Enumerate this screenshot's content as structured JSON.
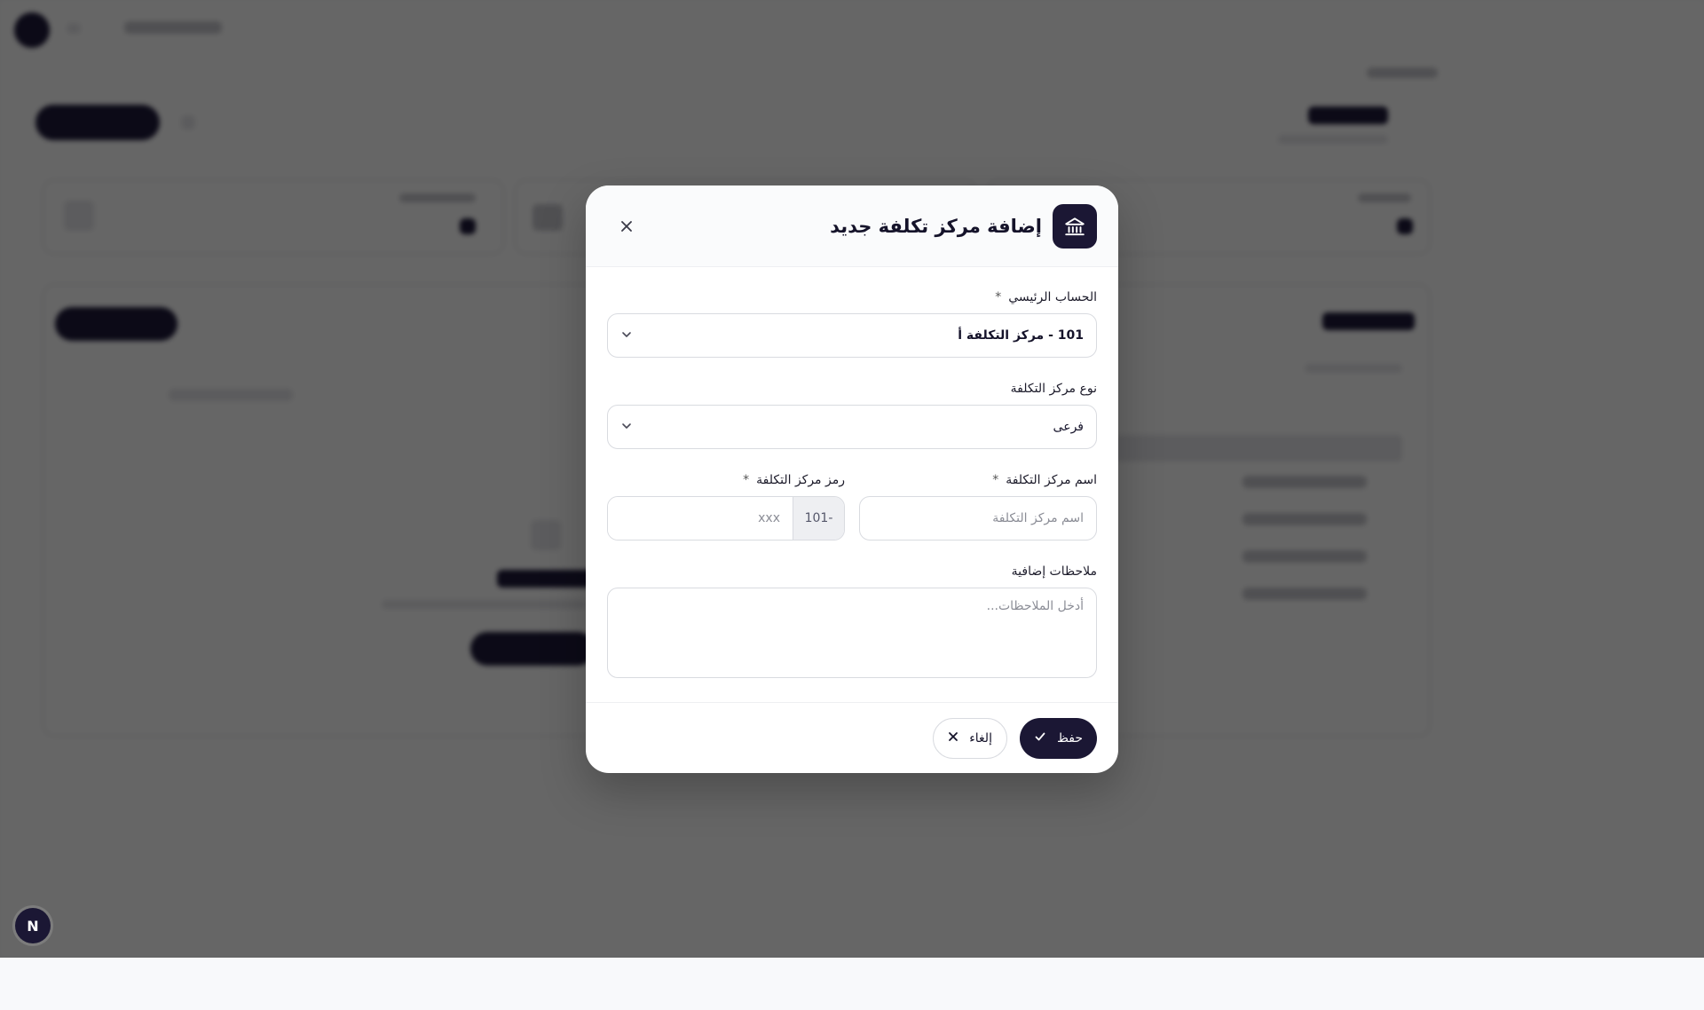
{
  "modal": {
    "title": "إضافة مركز تكلفة جديد",
    "close_label": "close",
    "fields": {
      "parent_account": {
        "label": "الحساب الرئيسي",
        "required_mark": "*",
        "value": "101 - مركز التكلفة أ"
      },
      "cost_center_type": {
        "label": "نوع مركز التكلفة",
        "value": "فرعى"
      },
      "cost_center_name": {
        "label": "اسم مركز التكلفة",
        "required_mark": "*",
        "placeholder": "اسم مركز التكلفة"
      },
      "cost_center_code": {
        "label": "رمز مركز التكلفة",
        "required_mark": "*",
        "prefix": "101-",
        "placeholder": "xxx"
      },
      "notes": {
        "label": "ملاحظات إضافية",
        "placeholder": "أدخل الملاحظات..."
      }
    },
    "footer": {
      "save_label": "حفظ",
      "cancel_label": "إلغاء"
    }
  },
  "fab": {
    "label": "N"
  },
  "colors": {
    "primary": "#1b1734",
    "overlay": "rgba(0,0,0,0.6)",
    "border": "#d9dbe0"
  },
  "icons": {
    "header": "building-columns-icon",
    "close": "close-icon",
    "dropdown": "chevron-down-icon",
    "save": "check-icon",
    "cancel": "close-icon"
  }
}
